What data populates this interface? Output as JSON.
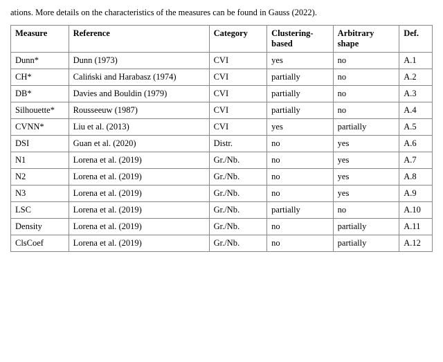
{
  "intro": "ations. More details on the characteristics of the measures can be found in Gauss (2022).",
  "table": {
    "headers": [
      {
        "id": "measure",
        "label": "Measure"
      },
      {
        "id": "reference",
        "label": "Reference"
      },
      {
        "id": "category",
        "label": "Category"
      },
      {
        "id": "clustering",
        "label": "Clustering-\nbased"
      },
      {
        "id": "arbitrary",
        "label": "Arbitrary\nshape"
      },
      {
        "id": "def",
        "label": "Def."
      }
    ],
    "rows": [
      {
        "measure": "Dunn*",
        "reference": "Dunn (1973)",
        "category": "CVI",
        "clustering": "yes",
        "arbitrary": "no",
        "def": "A.1"
      },
      {
        "measure": "CH*",
        "reference": "Caliński and Harabasz (1974)",
        "category": "CVI",
        "clustering": "partially",
        "arbitrary": "no",
        "def": "A.2"
      },
      {
        "measure": "DB*",
        "reference": "Davies and Bouldin (1979)",
        "category": "CVI",
        "clustering": "partially",
        "arbitrary": "no",
        "def": "A.3"
      },
      {
        "measure": "Silhouette*",
        "reference": "Rousseeuw (1987)",
        "category": "CVI",
        "clustering": "partially",
        "arbitrary": "no",
        "def": "A.4"
      },
      {
        "measure": "CVNN*",
        "reference": "Liu et al. (2013)",
        "category": "CVI",
        "clustering": "yes",
        "arbitrary": "partially",
        "def": "A.5"
      },
      {
        "measure": "DSI",
        "reference": "Guan et al. (2020)",
        "category": "Distr.",
        "clustering": "no",
        "arbitrary": "yes",
        "def": "A.6"
      },
      {
        "measure": "N1",
        "reference": "Lorena et al. (2019)",
        "category": "Gr./Nb.",
        "clustering": "no",
        "arbitrary": "yes",
        "def": "A.7"
      },
      {
        "measure": "N2",
        "reference": "Lorena et al. (2019)",
        "category": "Gr./Nb.",
        "clustering": "no",
        "arbitrary": "yes",
        "def": "A.8"
      },
      {
        "measure": "N3",
        "reference": "Lorena et al. (2019)",
        "category": "Gr./Nb.",
        "clustering": "no",
        "arbitrary": "yes",
        "def": "A.9"
      },
      {
        "measure": "LSC",
        "reference": "Lorena et al. (2019)",
        "category": "Gr./Nb.",
        "clustering": "partially",
        "arbitrary": "no",
        "def": "A.10"
      },
      {
        "measure": "Density",
        "reference": "Lorena et al. (2019)",
        "category": "Gr./Nb.",
        "clustering": "no",
        "arbitrary": "partially",
        "def": "A.11"
      },
      {
        "measure": "ClsCoef",
        "reference": "Lorena et al. (2019)",
        "category": "Gr./Nb.",
        "clustering": "no",
        "arbitrary": "partially",
        "def": "A.12"
      }
    ]
  }
}
